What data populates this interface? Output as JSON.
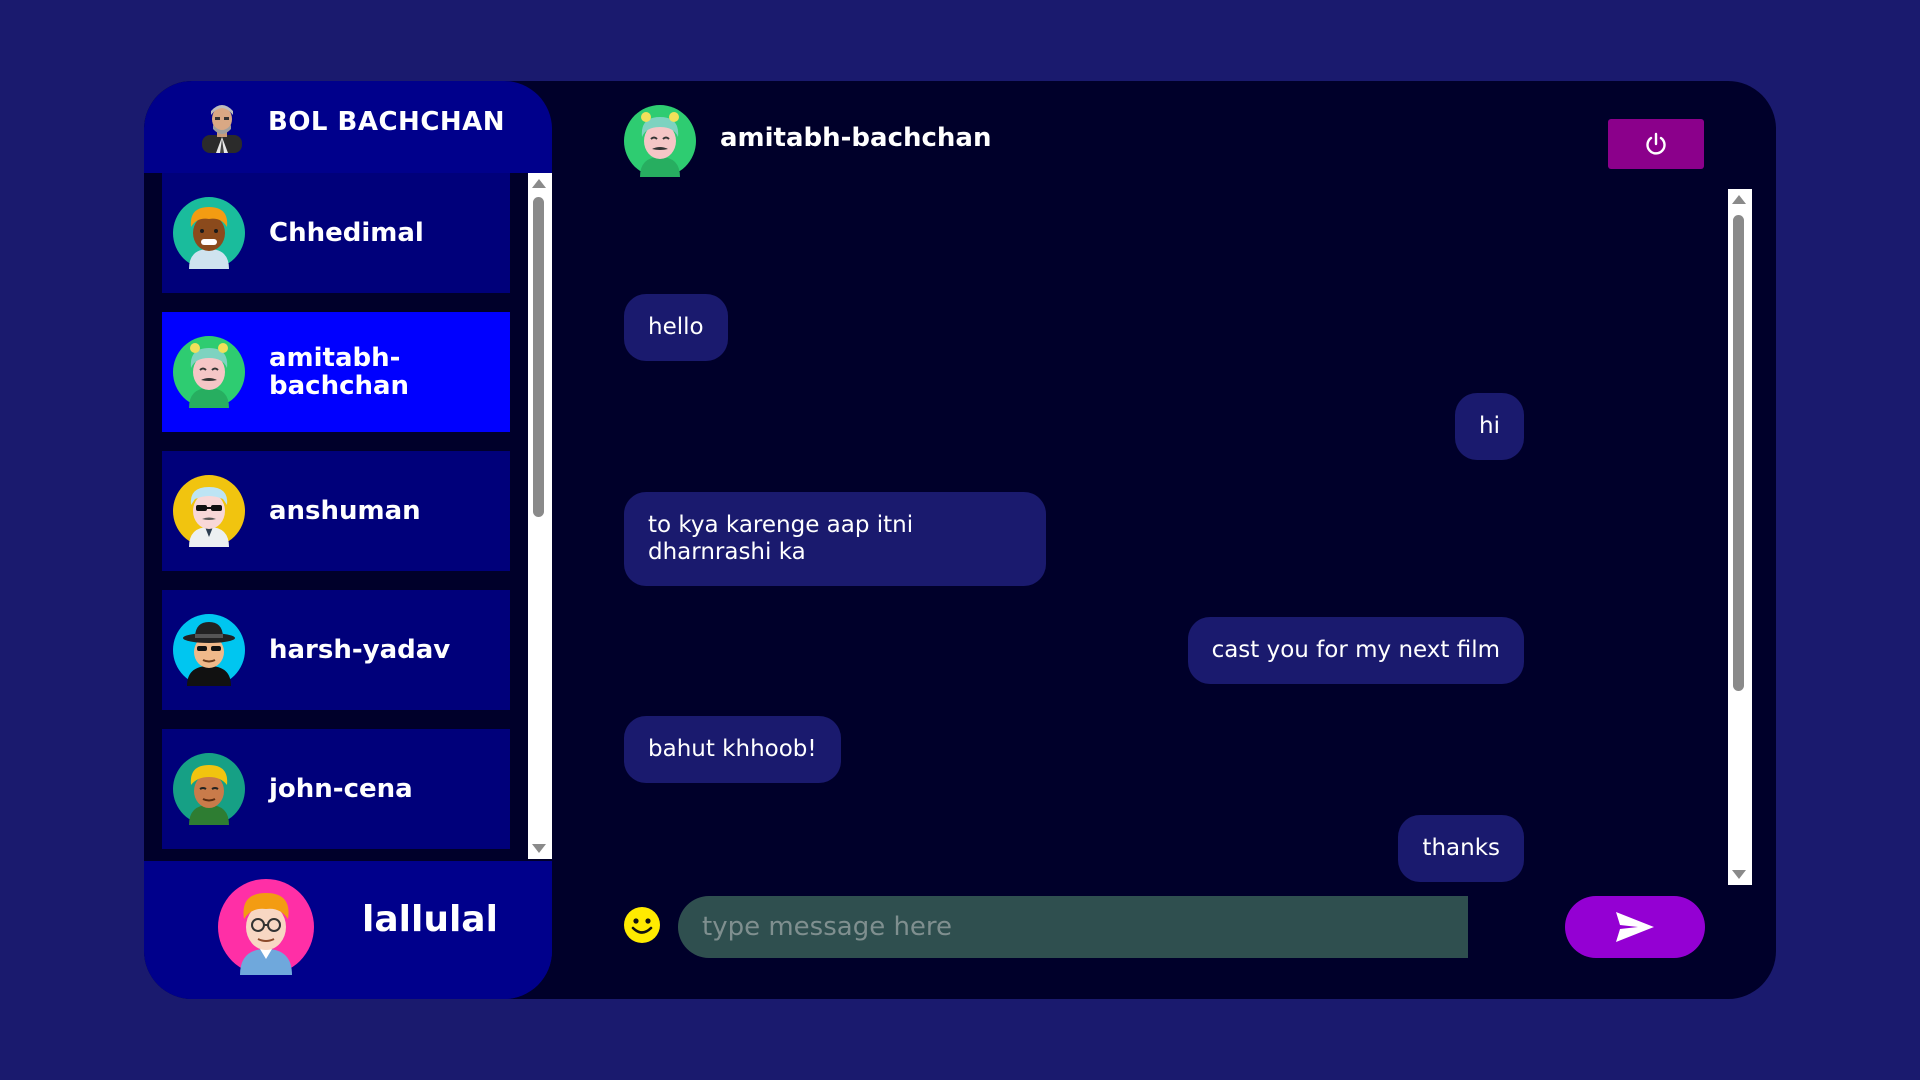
{
  "app": {
    "brand_title": "BOL BACHCHAN",
    "brand_logo_icon": "man-portrait-icon"
  },
  "colors": {
    "page_bg": "#1a1a6e",
    "panel_bg": "#00002a",
    "sidebar_bg": "#00008b",
    "contact_bg": "#00007a",
    "contact_active_bg": "#0000ff",
    "bubble_bg": "#1a1a6e",
    "logout_bg": "#8b008b",
    "send_bg": "#9400d3",
    "input_bg": "#2f4f4f"
  },
  "contacts": [
    {
      "name": "Chhedimal",
      "avatar": "avatar-curly-orange-hair-icon",
      "active": false
    },
    {
      "name": "amitabh-bachchan",
      "avatar": "avatar-green-hair-mustache-icon",
      "active": true
    },
    {
      "name": "anshuman",
      "avatar": "avatar-sunglasses-blue-hair-icon",
      "active": false
    },
    {
      "name": "harsh-yadav",
      "avatar": "avatar-black-hat-sunglasses-icon",
      "active": false
    },
    {
      "name": "john-cena",
      "avatar": "avatar-yellow-hair-icon",
      "active": false
    }
  ],
  "profile": {
    "name": "lallulal",
    "avatar": "avatar-orange-hair-glasses-icon"
  },
  "chat": {
    "recipient_name": "amitabh-bachchan",
    "recipient_avatar": "avatar-green-hair-mustache-icon",
    "logout_icon": "power-icon",
    "messages": [
      {
        "text": "hello",
        "side": "left"
      },
      {
        "text": "hi",
        "side": "right"
      },
      {
        "text": "to kya karenge aap itni dharnrashi ka",
        "side": "left"
      },
      {
        "text": "cast you for my next film",
        "side": "right"
      },
      {
        "text": "bahut khhoob!",
        "side": "left"
      },
      {
        "text": "thanks",
        "side": "right"
      },
      {
        "text": "😜😜",
        "side": "right"
      }
    ]
  },
  "composer": {
    "placeholder": "type message here",
    "emoji_icon": "smiley-icon",
    "send_icon": "send-arrow-icon"
  }
}
